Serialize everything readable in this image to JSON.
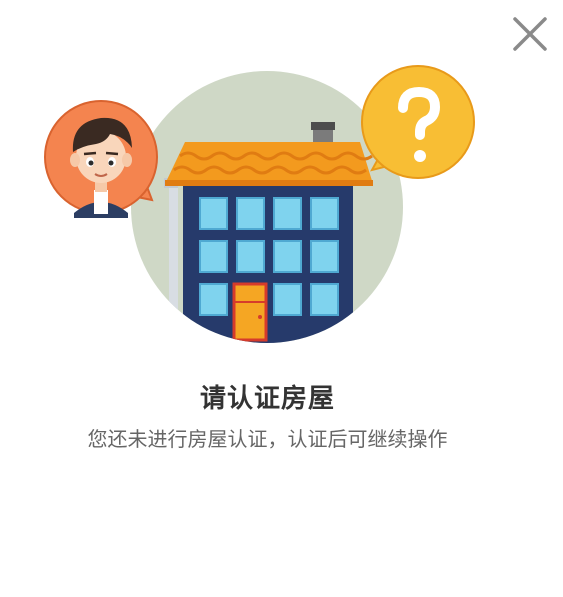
{
  "dialog": {
    "title": "请认证房屋",
    "message": "您还未进行房屋认证，认证后可继续操作",
    "close_icon": "close-icon"
  },
  "illustration": {
    "house_icon": "apartment-building-icon",
    "avatar_icon": "user-avatar-icon",
    "question_icon": "question-bubble-icon",
    "colors": {
      "circle_bg": "#cfd8c6",
      "building": "#263a6b",
      "roof": "#f39a1e",
      "window": "#7fd3ee",
      "door": "#f5a623",
      "question_bubble": "#f8be34",
      "avatar_bubble": "#f4844f"
    }
  }
}
